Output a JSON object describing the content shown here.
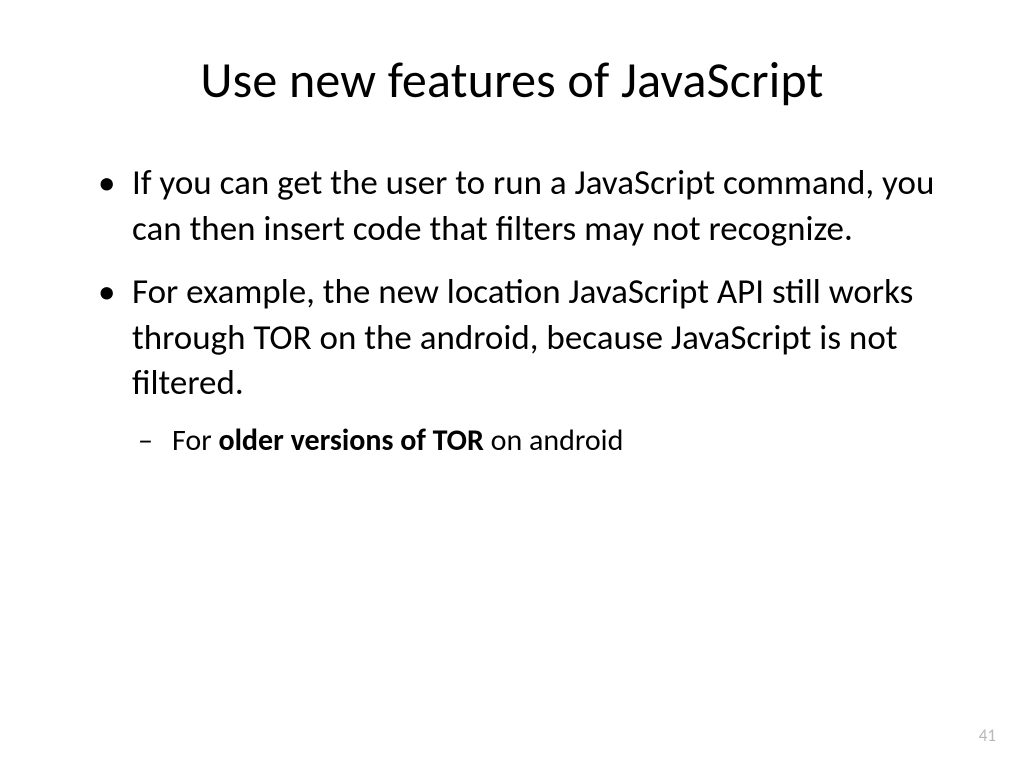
{
  "slide": {
    "title": "Use new features of JavaScript",
    "bullets": [
      {
        "text": "If you can get the user to run a JavaScript command, you can then insert code that filters may not recognize."
      },
      {
        "text": "For example, the new location JavaScript API still works through TOR on the android, because JavaScript is not filtered.",
        "sub": {
          "prefix": "For ",
          "bold": "older versions of TOR",
          "suffix": " on android"
        }
      }
    ],
    "page_number": "41"
  }
}
